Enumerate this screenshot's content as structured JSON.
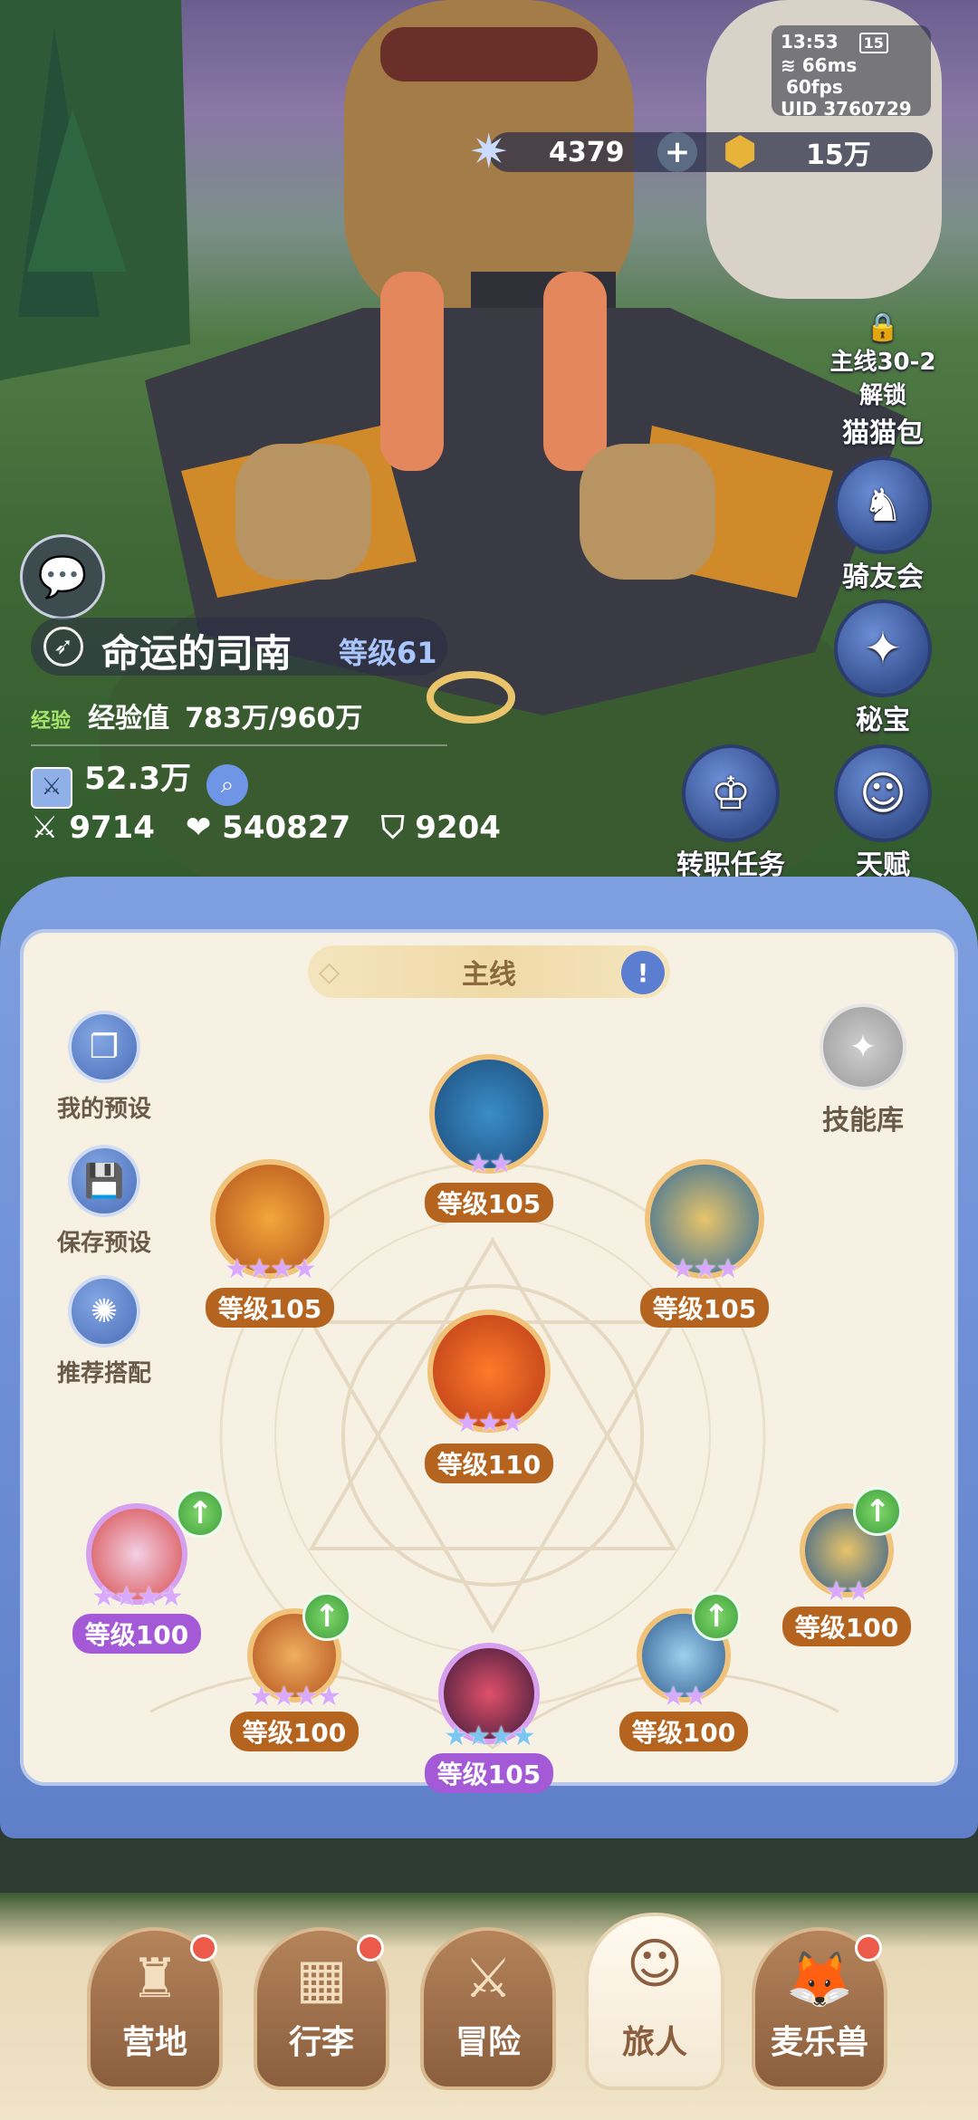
{
  "status": {
    "time": "13:53",
    "battery": "15",
    "ping": "66ms",
    "fps": "60fps",
    "uid": "UID 3760729"
  },
  "currency": {
    "stars": "4379",
    "plus": "+",
    "coins": "15万"
  },
  "side_buttons": [
    {
      "line1": "主线30-2",
      "line2": "解锁",
      "label": "猫猫包"
    },
    {
      "label": "骑友会"
    },
    {
      "label": "秘宝"
    },
    {
      "label": "转职任务"
    },
    {
      "label": "天赋"
    }
  ],
  "profile": {
    "name": "命运的司南",
    "level": "等级61",
    "exp_tag": "经验",
    "exp_label": "经验值",
    "exp_value": "783万/960万",
    "power": "52.3万",
    "attack": "9714",
    "hp": "540827",
    "defense": "9204"
  },
  "panel": {
    "tab": "主线",
    "skill_library": "技能库",
    "presets": [
      {
        "label": "我的预设"
      },
      {
        "label": "保存预设"
      },
      {
        "label": "推荐搭配"
      }
    ],
    "skills": [
      {
        "level": "等级105",
        "stars": "★★"
      },
      {
        "level": "等级105",
        "stars": "★★★★"
      },
      {
        "level": "等级105",
        "stars": "★★★"
      },
      {
        "level": "等级110",
        "stars": "★★★"
      },
      {
        "level": "等级100",
        "stars": "★★★★"
      },
      {
        "level": "等级100",
        "stars": "★★★★"
      },
      {
        "level": "等级105",
        "stars": "★★★★"
      },
      {
        "level": "等级100",
        "stars": "★★"
      },
      {
        "level": "等级100",
        "stars": "★★"
      }
    ]
  },
  "nav": [
    {
      "label": "营地"
    },
    {
      "label": "行李"
    },
    {
      "label": "冒险"
    },
    {
      "label": "旅人"
    },
    {
      "label": "麦乐兽"
    }
  ],
  "colors": {
    "panel_blue": "#6f8fd6",
    "level_orange": "#b5641f",
    "level_purple": "#a45ad6",
    "badge_red": "#ec5a4a"
  }
}
